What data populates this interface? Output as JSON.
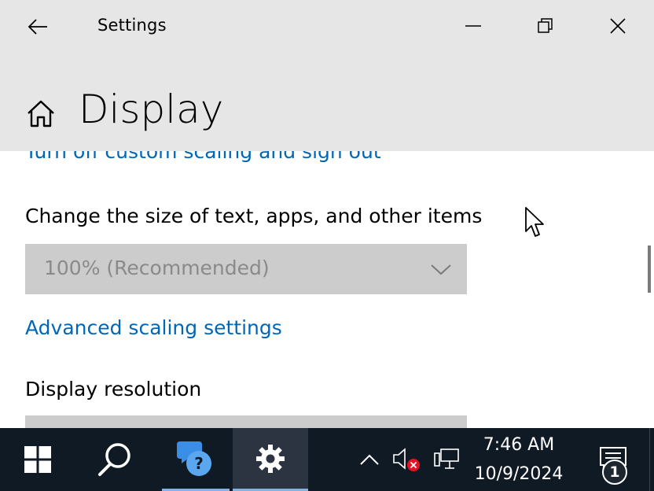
{
  "window": {
    "app_title": "Settings",
    "back_icon": "back-arrow-icon",
    "minimize_icon": "minimize-icon",
    "maximize_icon": "restore-icon",
    "close_icon": "close-icon"
  },
  "header": {
    "home_icon": "home-icon",
    "page_title": "Display"
  },
  "content": {
    "signout_link": "Turn off custom scaling and sign out",
    "scale_label": "Change the size of text, apps, and other items",
    "scale_dropdown": {
      "selected": "100% (Recommended)",
      "disabled": true
    },
    "advanced_link": "Advanced scaling settings",
    "resolution_label": "Display resolution"
  },
  "taskbar": {
    "icons": [
      "windows-start-icon",
      "search-icon",
      "help-icon",
      "settings-gear-icon",
      "chevron-up-icon",
      "volume-muted-icon",
      "network-icon",
      "action-center-icon"
    ],
    "clock_time": "7:46 AM",
    "clock_date": "10/9/2024",
    "notification_count": "1"
  },
  "colors": {
    "link": "#0067b8",
    "titlebar_bg": "#e6e6e6",
    "taskbar_bg": "#101a25",
    "dropdown_bg": "#cccccc",
    "taskbar_accent": "#86b3e0",
    "mute_badge": "#e81123"
  }
}
